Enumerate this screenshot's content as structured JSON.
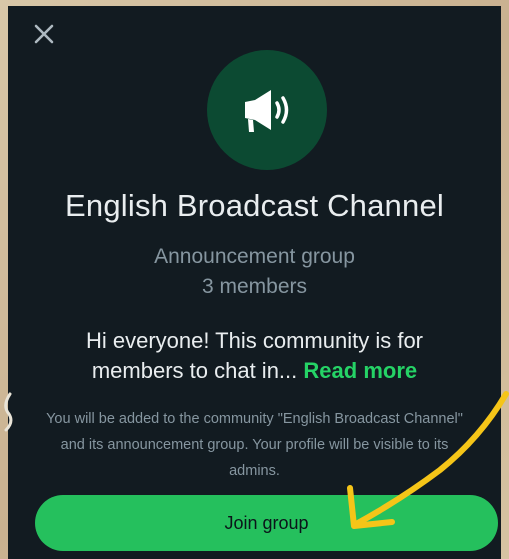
{
  "dialog": {
    "close_icon": "close-icon",
    "avatar_icon": "megaphone-icon",
    "title": "English Broadcast Channel",
    "group_type": "Announcement group",
    "member_count": "3 members",
    "description": "Hi everyone! This community is for members to chat in...",
    "read_more": "Read more",
    "notice": "You will be added to the community \"English Broadcast Channel\" and its announcement group. Your profile will be visible to its admins.",
    "join_button": "Join group"
  },
  "colors": {
    "background": "#121b21",
    "accent": "#25d366",
    "button": "#25c05d",
    "annotation_arrow": "#f5c518"
  }
}
